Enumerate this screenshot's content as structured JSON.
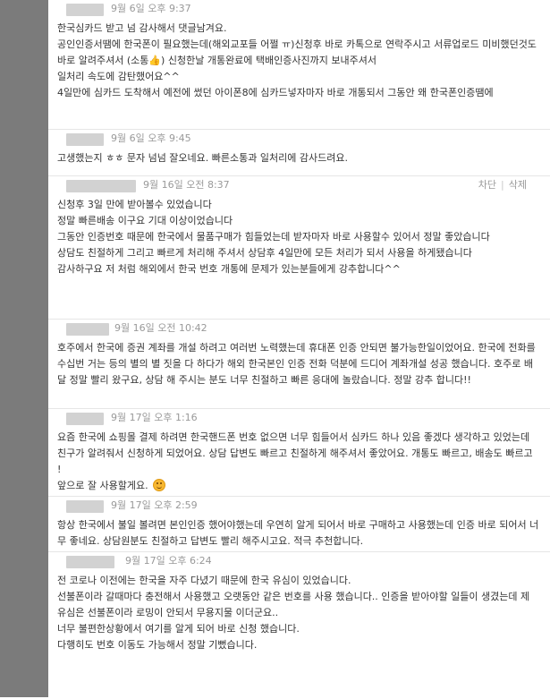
{
  "comments": [
    {
      "date": "9월 6일 오후 9:37",
      "lines": [
        "한국심카드 받고 넘 감사해서 댓글남겨요.",
        "공인인증서땜에 한국폰이 필요했는데(해외교포들 어쩔 ㅠ)신청후 바로 카톡으로 연락주시고 서류업로드 미비했던것도 바로 알려주셔서 (소통👍) 신청한날 개통완료에 택배인증사진까지 보내주셔서",
        "일처리 속도에 감탄했어요^^",
        "4일만에 심카드 도착해서 예전에 썼던 아이폰8에 심카드넣자마자 바로 개통되서 그동안 왜 한국폰인증땜에"
      ]
    },
    {
      "date": "9월 6일 오후 9:45",
      "lines": [
        "고생했는지 ㅎㅎ 문자 넘넘 잘오네요. 빠른소통과 일처리에 감사드려요."
      ]
    },
    {
      "date": "9월 16일 오전 8:37",
      "actions": [
        "차단",
        "삭제"
      ],
      "lines": [
        "신청후 3일 만에 받아볼수 있었습니다",
        "정말 빠른배송 이구요 기대 이상이었습니다",
        "그동안 인증번호 때문에 한국에서 물품구매가 힘들었는데 받자마자 바로 사용할수 있어서 정말 좋았습니다",
        "상담도 친절하게 그리고 빠르게 처리해 주셔서 상담후 4일만에 모든 처리가 되서 사용을 하게됐습니다",
        "감사하구요 저 처럼 해외에서 한국 번호 개통에 문제가 있는분들에게 강추합니다^^"
      ]
    },
    {
      "date": "9월 16일 오전 10:42",
      "lines": [
        "호주에서 한국에 증권 계좌를 개설 하려고 여러번 노력했는데 휴대폰 인증 안되면 불가능한일이었어요. 한국에 전화를 수십번 거는 등의 별의 별 짓을 다 하다가 해외 한국본인 인증 전화 덕분에 드디어 계좌개설 성공 했습니다. 호주로 배달 정말 빨리 왔구요, 상담 해 주시는 분도 너무 친절하고 빠른 응대에 놀랐습니다. 정말 강추 합니다!!"
      ]
    },
    {
      "date": "9월 17일 오후 1:16",
      "lines": [
        "요즘 한국에 쇼핑몰 결제 하려면 한국핸드폰 번호 없으면 너무 힘들어서 심카드 하나 있음 좋겠다 생각하고 있었는데 친구가 알려줘서 신청하게 되었어요. 상담 답변도 빠르고 친절하게 해주셔서 좋았어요. 개통도 빠르고, 배송도 빠르고 !",
        "앞으로 잘 사용할게요."
      ]
    },
    {
      "date": "9월 17일 오후 2:59",
      "lines": [
        "항상 한국에서 불일 볼려면 본인인증 했어야했는데 우연히 알게 되어서 바로 구매하고 사용했는데 인증 바로 되어서 너무 좋네요. 상담원분도 친절하고 답변도 빨리 해주시고요. 적극 추천합니다."
      ]
    },
    {
      "date": "9월 17일 오후 6:24",
      "lines": [
        "전 코로나 이전에는 한국을 자주 다녔기 때문에 한국 유심이 있었습니다.",
        "선불폰이라 갈때마다 충전해서 사용했고 오랫동안 같은 번호를 사용 했습니다.. 인증을 받아야할 일들이 생겼는데 제 유심은 선불폰이라 로밍이 안되서 무용지물 이더군요..",
        "너무 불편한상황에서 여기를 알게 되어 바로 신청 했습니다.",
        "다행히도 번호 이동도 가능해서 정말 기뻤습니다."
      ]
    }
  ],
  "colors": {
    "left_bar": "#7b7b7b",
    "name_blur": "#d2d2d2",
    "date_text": "#999999",
    "body_text": "#333333"
  },
  "icons": {
    "thumbs_up": "thumbs-up-icon",
    "smile": "smile-emoji-icon"
  }
}
